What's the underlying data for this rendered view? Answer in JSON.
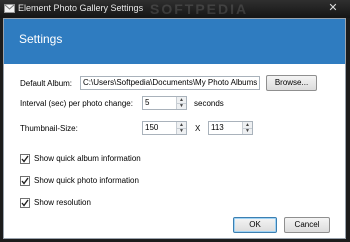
{
  "window": {
    "title": "Element Photo Gallery Settings",
    "watermark": "SOFTPEDIA",
    "close_label": "✕"
  },
  "banner": {
    "title": "Settings"
  },
  "form": {
    "album_label": "Default Album:",
    "album_value": "C:\\Users\\Softpedia\\Documents\\My Photo Albums",
    "browse_label": "Browse...",
    "interval_label": "Interval (sec) per photo change:",
    "interval_value": "5",
    "interval_unit": "seconds",
    "thumb_label": "Thumbnail-Size:",
    "thumb_width": "150",
    "thumb_separator": "X",
    "thumb_height": "113"
  },
  "options": [
    {
      "label": "Show quick album information",
      "checked": true
    },
    {
      "label": "Show quick photo information",
      "checked": true
    },
    {
      "label": "Show resolution",
      "checked": true
    }
  ],
  "buttons": {
    "ok": "OK",
    "cancel": "Cancel"
  },
  "colors": {
    "banner": "#2f7cc0",
    "titlebar": "#1c1c1c"
  }
}
